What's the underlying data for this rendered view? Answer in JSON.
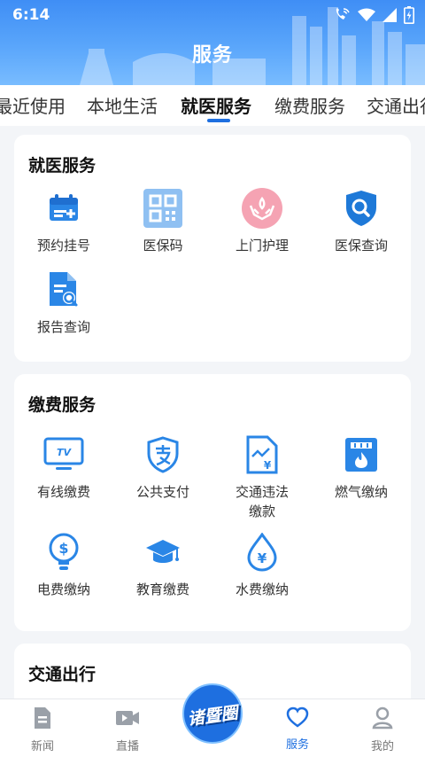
{
  "status_bar": {
    "time": "6:14"
  },
  "header": {
    "title": "服务"
  },
  "tabs": [
    {
      "label": "最近使用"
    },
    {
      "label": "本地生活"
    },
    {
      "label": "就医服务"
    },
    {
      "label": "缴费服务"
    },
    {
      "label": "交通出行"
    }
  ],
  "sections": {
    "medical": {
      "title": "就医服务",
      "items": [
        {
          "label": "预约挂号",
          "icon": "calendar-icon"
        },
        {
          "label": "医保码",
          "icon": "qr-code-icon"
        },
        {
          "label": "上门护理",
          "icon": "care-hands-icon"
        },
        {
          "label": "医保查询",
          "icon": "shield-search-icon"
        },
        {
          "label": "报告查询",
          "icon": "report-search-icon"
        }
      ]
    },
    "payment": {
      "title": "缴费服务",
      "items": [
        {
          "label": "有线缴费",
          "icon": "tv-icon"
        },
        {
          "label": "公共支付",
          "icon": "alipay-shield-icon"
        },
        {
          "label": "交通违法缴款",
          "icon": "traffic-fine-icon"
        },
        {
          "label": "燃气缴纳",
          "icon": "gas-icon"
        },
        {
          "label": "电费缴纳",
          "icon": "electric-bulb-icon"
        },
        {
          "label": "教育缴费",
          "icon": "graduation-cap-icon"
        },
        {
          "label": "水费缴纳",
          "icon": "water-drop-icon"
        }
      ]
    },
    "traffic": {
      "title": "交通出行"
    }
  },
  "bottom_nav": {
    "news": "新闻",
    "live": "直播",
    "center_logo": "诸暨圈",
    "services": "服务",
    "mine": "我的"
  },
  "colors": {
    "accent": "#1e6fe0",
    "header_start": "#3f8ef5",
    "icon_blue": "#2a86e6"
  }
}
